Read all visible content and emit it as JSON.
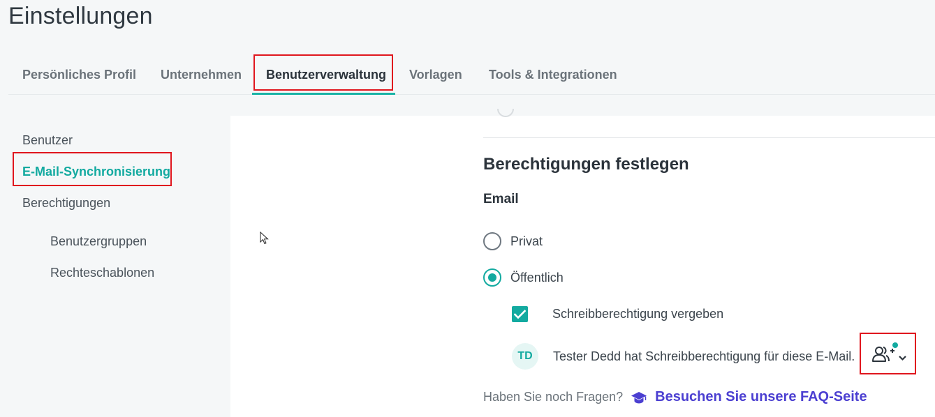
{
  "page": {
    "title": "Einstellungen"
  },
  "tabs": [
    {
      "label": "Persönliches Profil",
      "active": false
    },
    {
      "label": "Unternehmen",
      "active": false
    },
    {
      "label": "Benutzerverwaltung",
      "active": true
    },
    {
      "label": "Vorlagen",
      "active": false
    },
    {
      "label": "Tools & Integrationen",
      "active": false
    }
  ],
  "sidebar": {
    "items": [
      {
        "label": "Benutzer",
        "active": false
      },
      {
        "label": "E-Mail-Synchronisierung",
        "active": true
      },
      {
        "label": "Berechtigungen",
        "active": false
      },
      {
        "label": "Benutzergruppen",
        "active": false
      },
      {
        "label": "Rechteschablonen",
        "active": false
      }
    ]
  },
  "permissions": {
    "title": "Berechtigungen festlegen",
    "subtitle": "Email",
    "options": [
      {
        "label": "Privat",
        "selected": false
      },
      {
        "label": "Öffentlich",
        "selected": true
      }
    ],
    "write_checkbox": {
      "label": "Schreibberechtigung vergeben",
      "checked": true
    },
    "user": {
      "initials": "TD",
      "text": "Tester Dedd hat Schreibberechtigung für diese E-Mail."
    },
    "permission_button_icon": "add-user-icon"
  },
  "faq": {
    "question": "Haben Sie noch Fragen?",
    "link": "Besuchen Sie unsere FAQ-Seite",
    "icon": "graduation-cap-icon"
  },
  "colors": {
    "accent": "#13aaa0",
    "link": "#4b3fd1",
    "highlight_box": "#e0161e"
  }
}
